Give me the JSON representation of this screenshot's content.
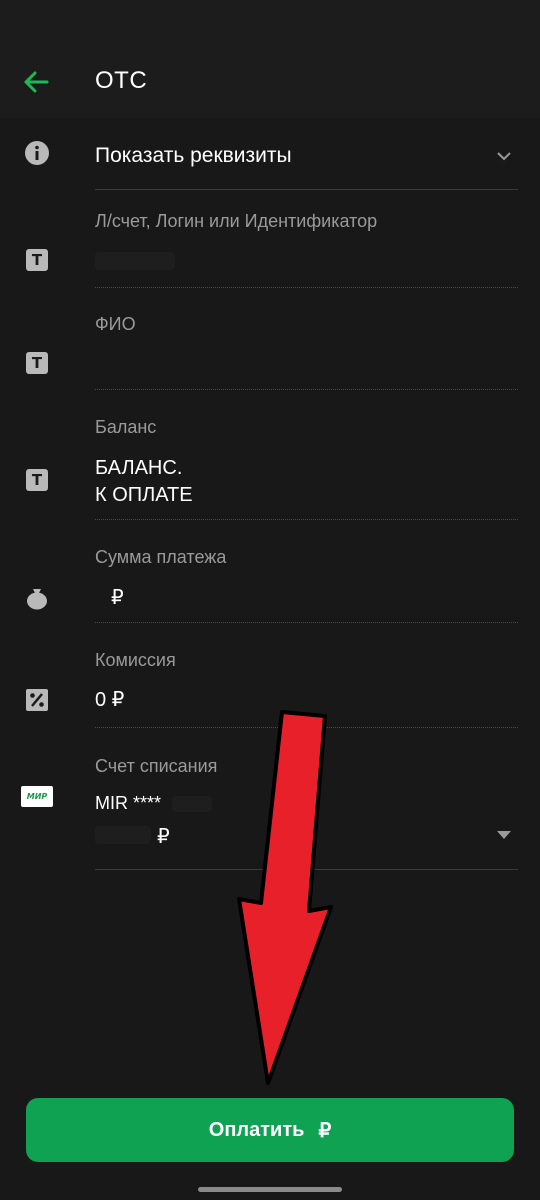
{
  "app_bar": {
    "title": "ОТС"
  },
  "details": {
    "label": "Показать реквизиты"
  },
  "fields": {
    "account": {
      "label": "Л/счет, Логин или Идентификатор",
      "value": ""
    },
    "fio": {
      "label": "ФИО",
      "value": ""
    },
    "balance": {
      "label": "Баланс",
      "value_line1": "БАЛАНС.",
      "value_line2": "К ОПЛАТЕ"
    },
    "amount": {
      "label": "Сумма платежа",
      "value": "₽"
    },
    "commission": {
      "label": "Комиссия",
      "value": "0 ₽"
    },
    "debit_account": {
      "label": "Счет списания",
      "card": "MIR ****",
      "balance": "₽"
    }
  },
  "icons": {
    "mir_logo_text": "МИР"
  },
  "pay_button": {
    "label": "Оплатить",
    "currency": "₽"
  },
  "colors": {
    "accent": "#0ea252",
    "back_arrow": "#1db954",
    "background": "#181818",
    "annotation_arrow": "#e8202a"
  }
}
